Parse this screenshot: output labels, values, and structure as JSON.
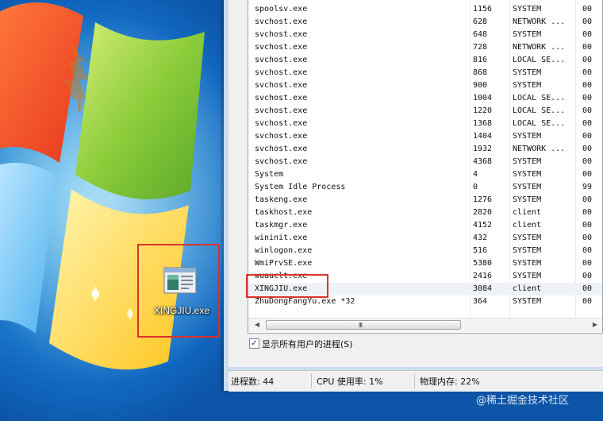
{
  "desktop": {
    "icon": {
      "label": "XINGJIU.exe",
      "icon_name": "exe-window-icon"
    }
  },
  "process_list": {
    "rows": [
      {
        "name": "spoolsv.exe",
        "pid": "1156",
        "user": "SYSTEM",
        "cpu": "00"
      },
      {
        "name": "svchost.exe",
        "pid": "628",
        "user": "NETWORK ...",
        "cpu": "00"
      },
      {
        "name": "svchost.exe",
        "pid": "648",
        "user": "SYSTEM",
        "cpu": "00"
      },
      {
        "name": "svchost.exe",
        "pid": "728",
        "user": "NETWORK ...",
        "cpu": "00"
      },
      {
        "name": "svchost.exe",
        "pid": "816",
        "user": "LOCAL SE...",
        "cpu": "00"
      },
      {
        "name": "svchost.exe",
        "pid": "868",
        "user": "SYSTEM",
        "cpu": "00"
      },
      {
        "name": "svchost.exe",
        "pid": "900",
        "user": "SYSTEM",
        "cpu": "00"
      },
      {
        "name": "svchost.exe",
        "pid": "1004",
        "user": "LOCAL SE...",
        "cpu": "00"
      },
      {
        "name": "svchost.exe",
        "pid": "1220",
        "user": "LOCAL SE...",
        "cpu": "00"
      },
      {
        "name": "svchost.exe",
        "pid": "1368",
        "user": "LOCAL SE...",
        "cpu": "00"
      },
      {
        "name": "svchost.exe",
        "pid": "1404",
        "user": "SYSTEM",
        "cpu": "00"
      },
      {
        "name": "svchost.exe",
        "pid": "1932",
        "user": "NETWORK ...",
        "cpu": "00"
      },
      {
        "name": "svchost.exe",
        "pid": "4368",
        "user": "SYSTEM",
        "cpu": "00"
      },
      {
        "name": "System",
        "pid": "4",
        "user": "SYSTEM",
        "cpu": "00"
      },
      {
        "name": "System Idle Process",
        "pid": "0",
        "user": "SYSTEM",
        "cpu": "99"
      },
      {
        "name": "taskeng.exe",
        "pid": "1276",
        "user": "SYSTEM",
        "cpu": "00"
      },
      {
        "name": "taskhost.exe",
        "pid": "2820",
        "user": "client",
        "cpu": "00"
      },
      {
        "name": "taskmgr.exe",
        "pid": "4152",
        "user": "client",
        "cpu": "00"
      },
      {
        "name": "wininit.exe",
        "pid": "432",
        "user": "SYSTEM",
        "cpu": "00"
      },
      {
        "name": "winlogon.exe",
        "pid": "516",
        "user": "SYSTEM",
        "cpu": "00"
      },
      {
        "name": "WmiPrvSE.exe",
        "pid": "5380",
        "user": "SYSTEM",
        "cpu": "00"
      },
      {
        "name": "wuauclt.exe",
        "pid": "2416",
        "user": "SYSTEM",
        "cpu": "00"
      },
      {
        "name": "XINGJIU.exe",
        "pid": "3084",
        "user": "client",
        "cpu": "00"
      },
      {
        "name": "ZhuDongFangYu.exe *32",
        "pid": "364",
        "user": "SYSTEM",
        "cpu": "00"
      }
    ],
    "scroll_grip": "III"
  },
  "show_all_users": {
    "label": "显示所有用户的进程(S)",
    "checked": true
  },
  "status_bar": {
    "processes": "进程数: 44",
    "cpu_usage": "CPU 使用率: 1%",
    "memory": "物理内存: 22%"
  },
  "watermark": "@稀土掘金技术社区",
  "colors": {
    "highlight_box": "#d9332b",
    "desktop_blue": "#1167c0"
  }
}
